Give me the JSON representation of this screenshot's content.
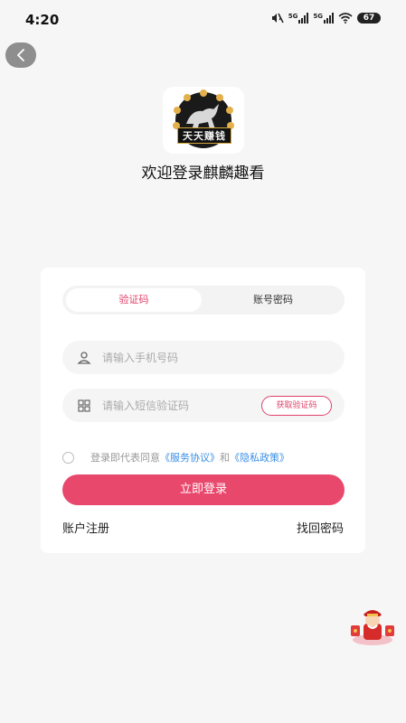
{
  "status_bar": {
    "time": "4:20",
    "network_1": "5G",
    "network_2": "5G",
    "battery": "67",
    "icons": [
      "mute-icon",
      "signal-icon",
      "signal-icon",
      "wifi-icon",
      "battery-icon"
    ]
  },
  "header": {
    "back_icon": "chevron-left-icon",
    "logo_text": "天天赚钱",
    "welcome": "欢迎登录麒麟趣看"
  },
  "login": {
    "tabs": [
      "验证码",
      "账号密码"
    ],
    "active_tab": 0,
    "phone_placeholder": "请输入手机号码",
    "code_placeholder": "请输入短信验证码",
    "get_code_label": "获取验证码",
    "agreement_prefix": "登录即代表同意",
    "service_agreement": "《服务协议》",
    "agreement_and": "和",
    "privacy_policy": "《隐私政策》",
    "login_button": "立即登录",
    "register_link": "账户注册",
    "forgot_link": "找回密码"
  },
  "colors": {
    "accent": "#e9486d",
    "link": "#3a8ee6",
    "background": "#f6f6f6"
  }
}
